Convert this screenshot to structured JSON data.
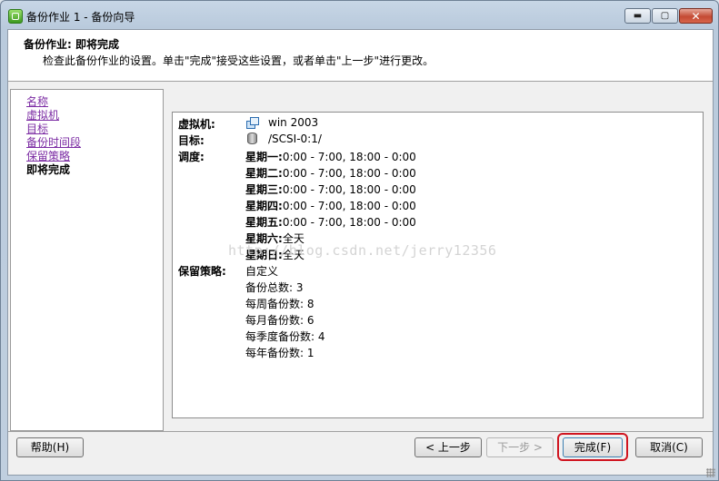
{
  "window": {
    "title": "备份作业 1 - 备份向导",
    "controls": {
      "minimize": "▬",
      "maximize": "▢",
      "close": "✕"
    }
  },
  "header": {
    "title": "备份作业:   即将完成",
    "description": "检查此备份作业的设置。单击\"完成\"接受这些设置，或者单击\"上一步\"进行更改。"
  },
  "nav": {
    "items": [
      {
        "label": "名称"
      },
      {
        "label": "虚拟机"
      },
      {
        "label": "目标"
      },
      {
        "label": "备份时间段"
      },
      {
        "label": "保留策略"
      },
      {
        "label": "即将完成"
      }
    ]
  },
  "summary": {
    "vm_label": "虚拟机:",
    "vm_value": "win 2003",
    "target_label": "目标:",
    "target_value": "/SCSI-0:1/",
    "schedule_label": "调度:",
    "schedule": [
      {
        "day": "星期一:",
        "value": "0:00 - 7:00, 18:00 - 0:00"
      },
      {
        "day": "星期二:",
        "value": "0:00 - 7:00, 18:00 - 0:00"
      },
      {
        "day": "星期三:",
        "value": "0:00 - 7:00, 18:00 - 0:00"
      },
      {
        "day": "星期四:",
        "value": "0:00 - 7:00, 18:00 - 0:00"
      },
      {
        "day": "星期五:",
        "value": "0:00 - 7:00, 18:00 - 0:00"
      },
      {
        "day": "星期六:",
        "value": "全天"
      },
      {
        "day": "星期日:",
        "value": "全天"
      }
    ],
    "retention_label": "保留策略:",
    "retention_lines": [
      "自定义",
      "备份总数: 3",
      "每周备份数: 8",
      "每月备份数: 6",
      "每季度备份数: 4",
      "每年备份数: 1"
    ],
    "watermark": "http://blog.csdn.net/jerry12356"
  },
  "buttons": {
    "help": "帮助(H)",
    "back": "< 上一步",
    "next": "下一步 >",
    "finish": "完成(F)",
    "cancel": "取消(C)"
  },
  "colors": {
    "visited_link": "#7b2ba3",
    "highlight": "#d0141f"
  }
}
